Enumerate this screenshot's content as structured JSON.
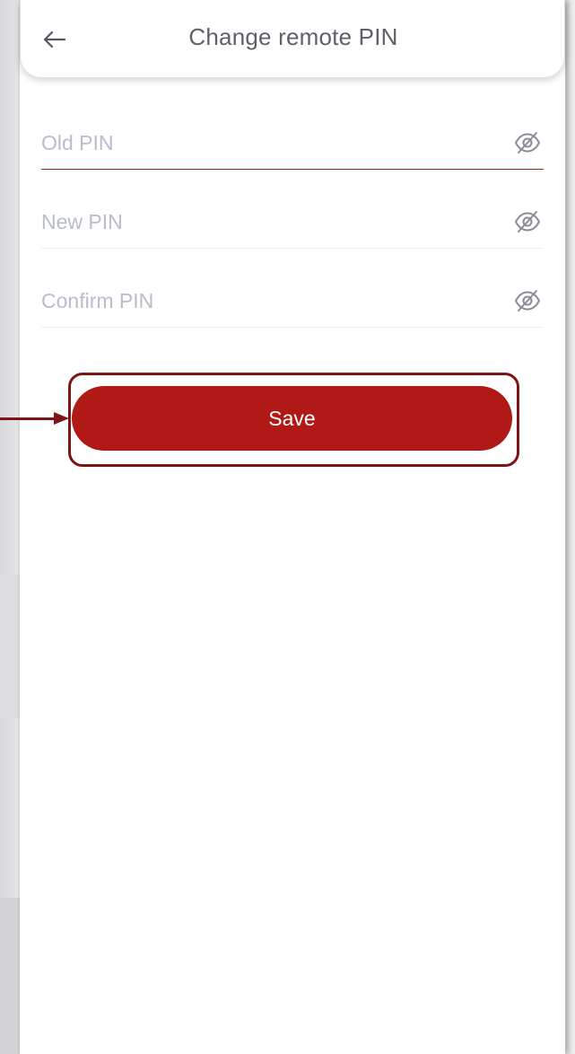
{
  "header": {
    "title": "Change remote PIN",
    "back_icon": "arrow-left-icon"
  },
  "form": {
    "fields": [
      {
        "placeholder": "Old PIN",
        "value": "",
        "active": true,
        "toggle_icon": "eye-slash-icon"
      },
      {
        "placeholder": "New PIN",
        "value": "",
        "active": false,
        "toggle_icon": "eye-slash-icon"
      },
      {
        "placeholder": "Confirm PIN",
        "value": "",
        "active": false,
        "toggle_icon": "eye-slash-icon"
      }
    ]
  },
  "actions": {
    "save_label": "Save"
  },
  "colors": {
    "accent": "#b01916",
    "highlight": "#7f1416",
    "title_text": "#5f6068",
    "placeholder": "#b9bccb",
    "active_underline": "#a31c20"
  }
}
